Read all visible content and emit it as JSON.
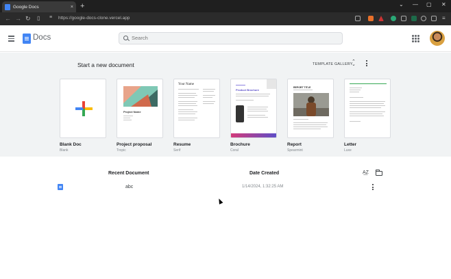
{
  "browser": {
    "tab_title": "Google Docs",
    "tab_close": "×",
    "new_tab": "+",
    "url": "https://google-docs-clone.vercel.app",
    "window_controls": [
      "⌄",
      "—",
      "▢",
      "✕"
    ]
  },
  "header": {
    "app_title": "Docs",
    "search_placeholder": "Search"
  },
  "templates": {
    "section_title": "Start a new document",
    "gallery_label": "TEMPLATE GALLERY",
    "items": [
      {
        "name": "Blank Doc",
        "sub": "Blank"
      },
      {
        "name": "Project proposal",
        "sub": "Tropic",
        "thumb_title": "Project Name"
      },
      {
        "name": "Resume",
        "sub": "Serif",
        "thumb_title": "Your Name"
      },
      {
        "name": "Brochure",
        "sub": "Coral",
        "thumb_title": "Product Brochure"
      },
      {
        "name": "Report",
        "sub": "Spearmint",
        "thumb_title": "REPORT TITLE"
      },
      {
        "name": "Letter",
        "sub": "Luxe"
      }
    ]
  },
  "recent": {
    "col_document": "Recent Document",
    "col_date": "Date Created",
    "rows": [
      {
        "name": "abc",
        "date": "1/14/2024, 1:32:25 AM"
      }
    ]
  },
  "colors": {
    "accent": "#4285f4",
    "section_bg": "#f1f3f4"
  }
}
